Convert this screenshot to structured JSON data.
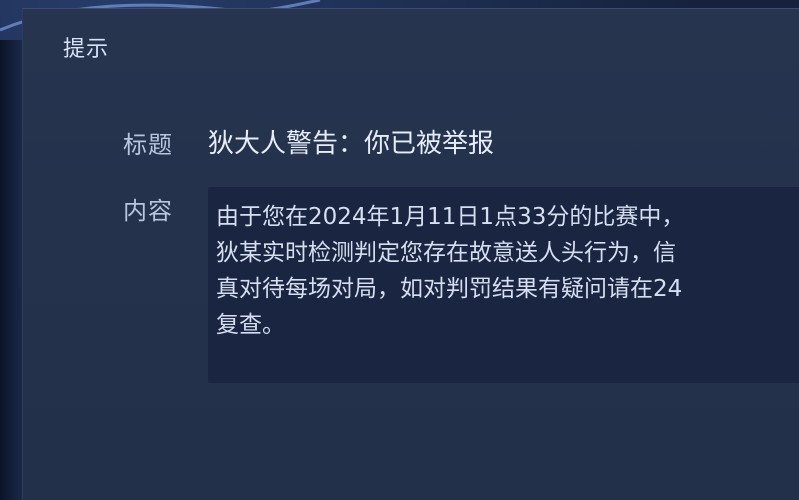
{
  "dialog": {
    "title": "提示",
    "title_field_label": "标题",
    "title_value": "狄大人警告：你已被举报",
    "content_field_label": "内容",
    "content_lines": [
      "由于您在2024年1月11日1点33分的比赛中，",
      "狄某实时检测判定您存在故意送人头行为，信",
      "真对待每场对局，如对判罚结果有疑问请在24",
      "复查。"
    ]
  },
  "colors": {
    "dialog_background": "#24324c",
    "content_box_background": "#1a2641",
    "text_primary": "#e6edf8",
    "text_label": "#b8c6dd"
  },
  "icons": {
    "top_left_ornament": "swirl-ornament-icon"
  }
}
